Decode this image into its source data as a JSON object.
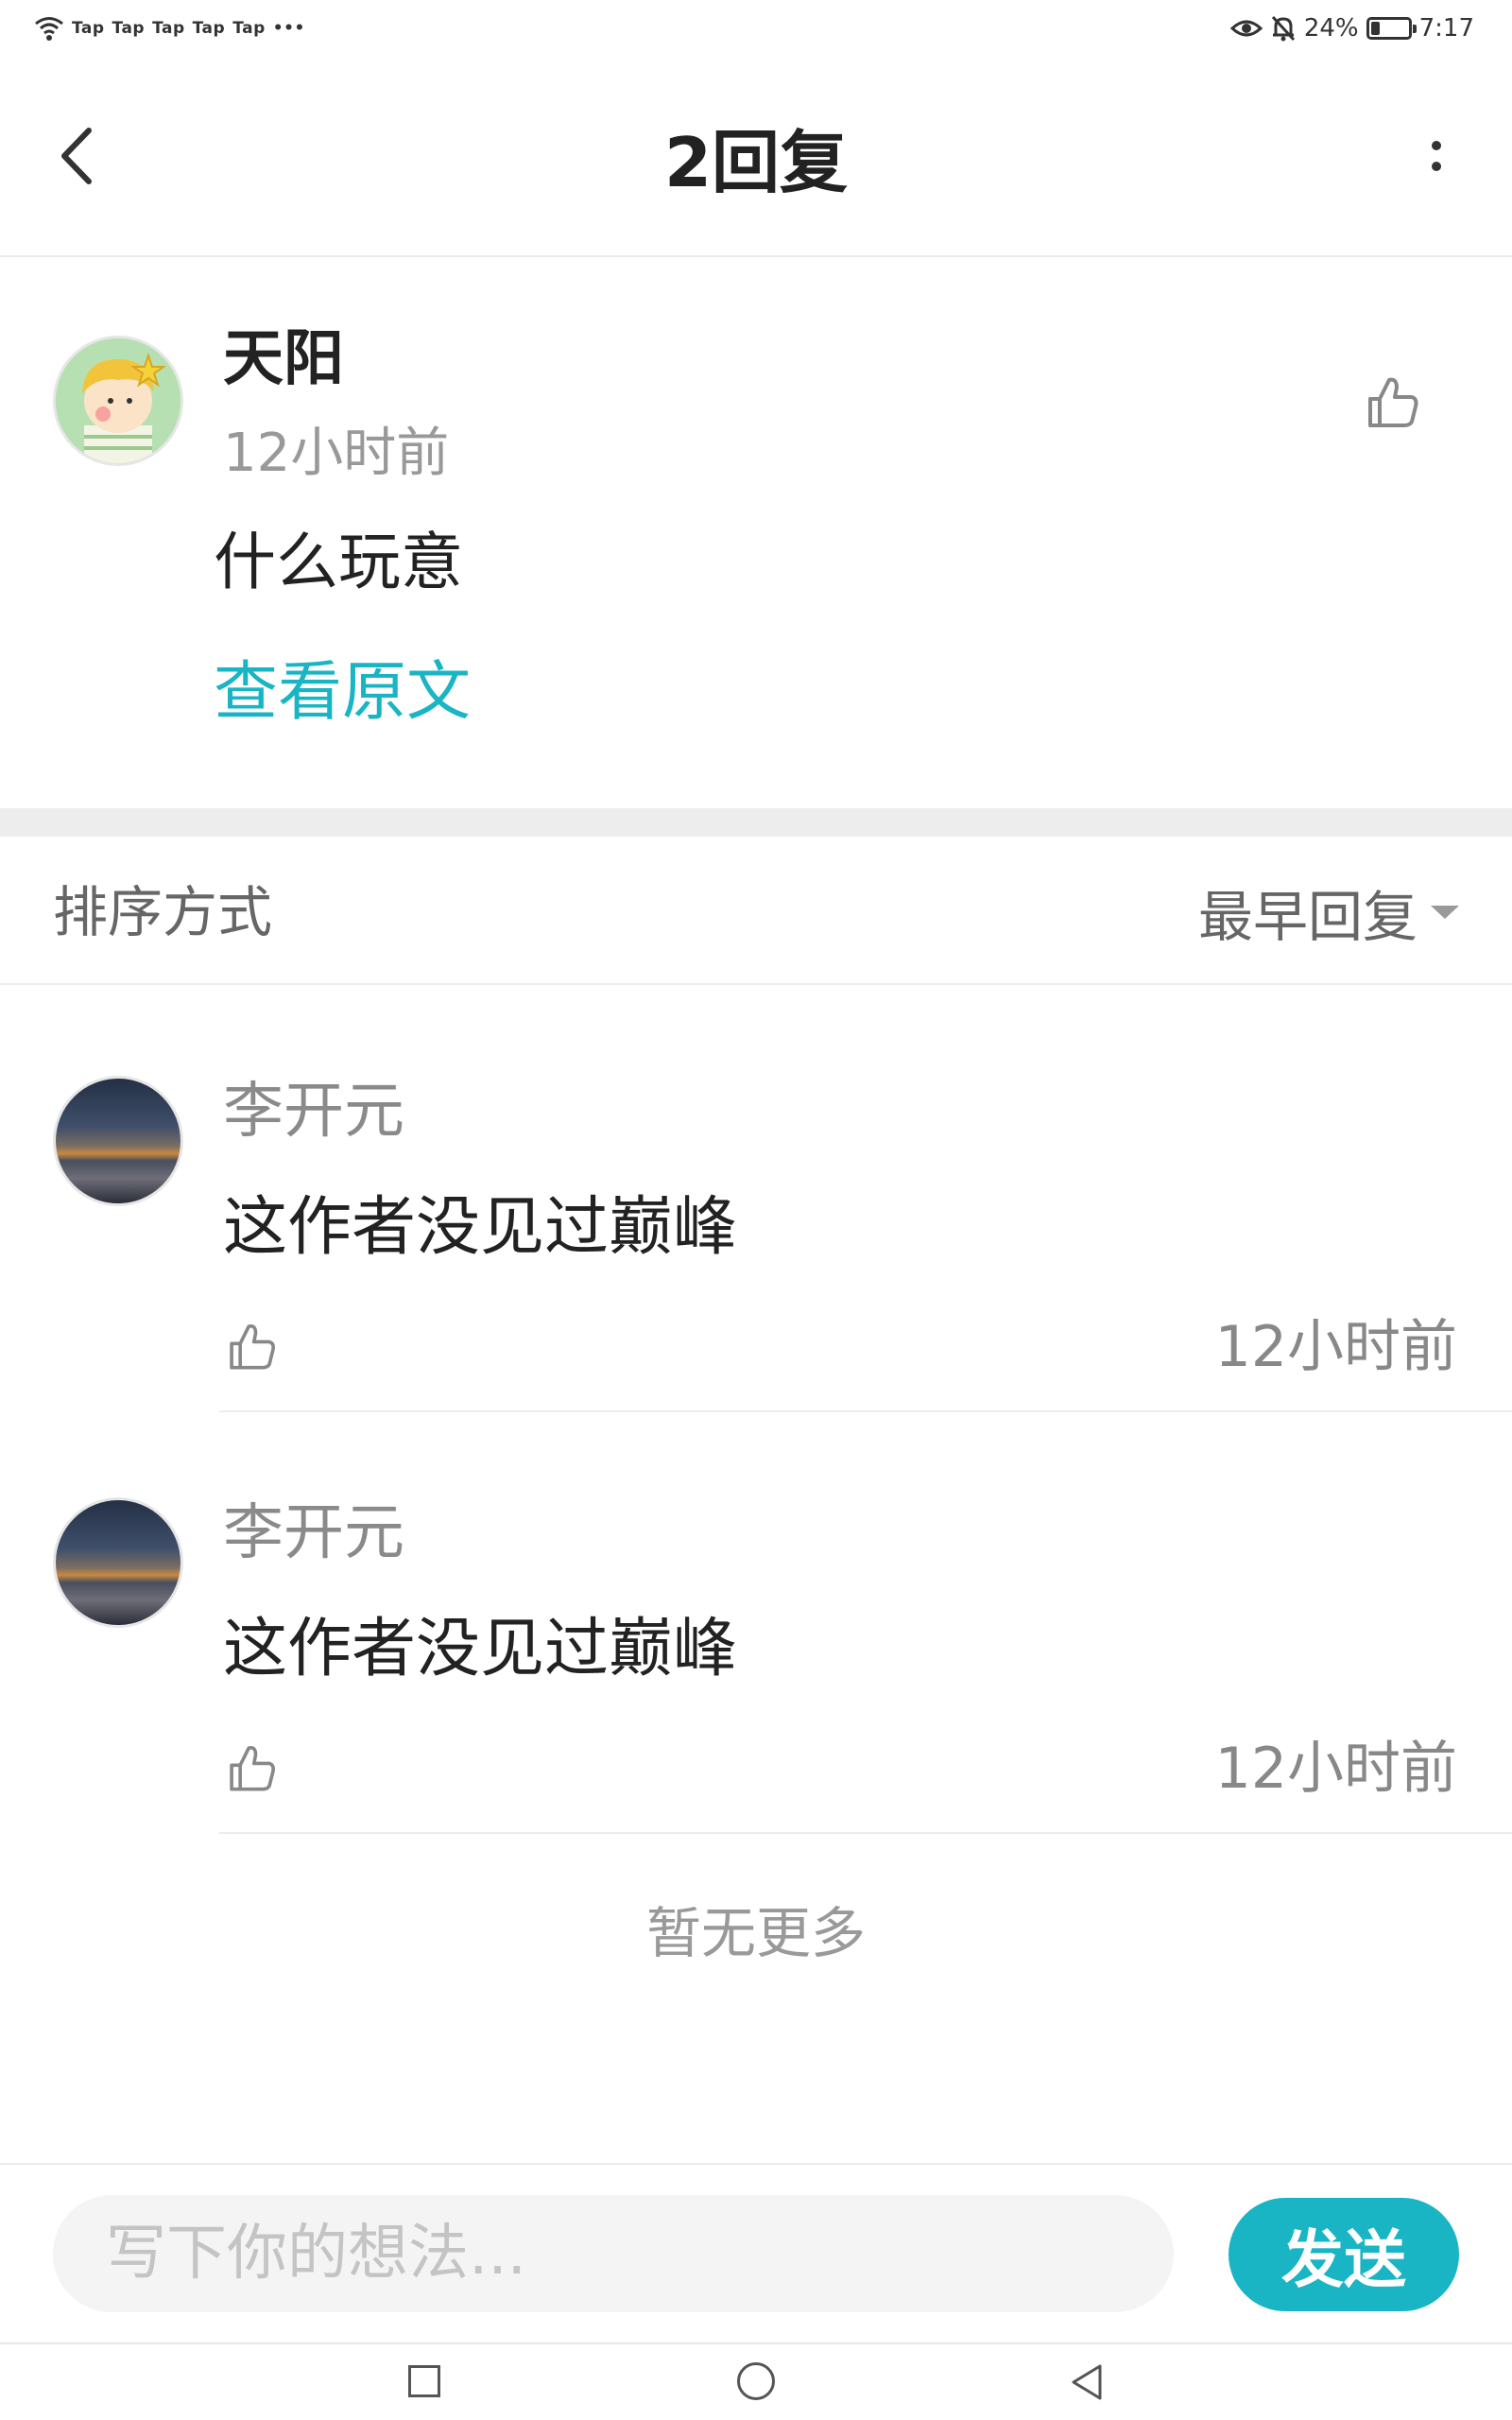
{
  "status_bar": {
    "tap_labels": [
      "Tap",
      "Tap",
      "Tap",
      "Tap",
      "Tap"
    ],
    "more": "•••",
    "battery_percent": "24%",
    "battery_level": 0.24,
    "time": "7:17",
    "icons": [
      "wifi-icon",
      "eye-icon",
      "bell-off-icon",
      "battery-icon"
    ]
  },
  "header": {
    "title": "2回复",
    "back_icon": "chevron-left-icon",
    "more_icon": "more-vertical-icon"
  },
  "main_comment": {
    "author": "天阳",
    "time": "12小时前",
    "content": "什么玩意",
    "view_original": "查看原文",
    "like_icon": "thumbs-up-icon"
  },
  "sort": {
    "label": "排序方式",
    "selected": "最早回复"
  },
  "replies": [
    {
      "author": "李开元",
      "content": "这作者没见过巅峰",
      "time": "12小时前"
    },
    {
      "author": "李开元",
      "content": "这作者没见过巅峰",
      "time": "12小时前"
    }
  ],
  "no_more": "暂无更多",
  "input": {
    "placeholder": "写下你的想法...",
    "value": ""
  },
  "send_button": "发送",
  "colors": {
    "accent": "#19b5c4",
    "divider": "#ededed",
    "secondary_text": "#999999"
  },
  "nav_bar": {
    "icons": [
      "recent-apps-icon",
      "home-icon",
      "back-triangle-icon"
    ]
  }
}
